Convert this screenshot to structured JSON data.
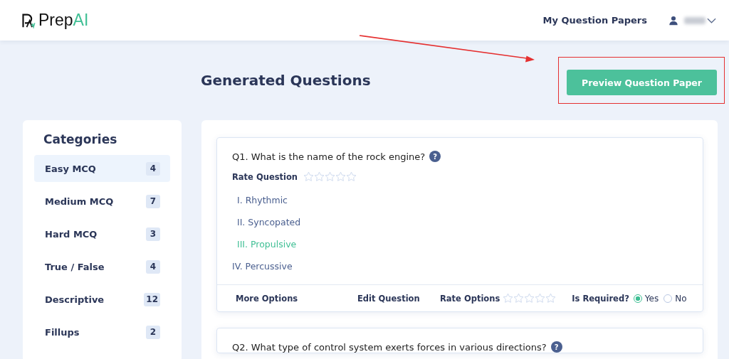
{
  "header": {
    "logo": {
      "text": "Prep",
      "accent": "AI"
    },
    "nav_link": "My Question Papers"
  },
  "title": "Generated Questions",
  "preview_button": {
    "label": "Preview Question Paper",
    "highlighted": true
  },
  "categories": {
    "title": "Categories",
    "items": [
      {
        "label": "Easy MCQ",
        "count": "4",
        "selected": true
      },
      {
        "label": "Medium MCQ",
        "count": "7",
        "selected": false
      },
      {
        "label": "Hard MCQ",
        "count": "3",
        "selected": false
      },
      {
        "label": "True / False",
        "count": "4",
        "selected": false
      },
      {
        "label": "Descriptive",
        "count": "12",
        "selected": false
      },
      {
        "label": "Fillups",
        "count": "2",
        "selected": false
      }
    ]
  },
  "questions": [
    {
      "text": "Q1. What is the name of the rock engine?",
      "help": "?",
      "rate_label": "Rate Question",
      "stars": 0,
      "options": [
        {
          "text": "I. Rhythmic",
          "correct": false
        },
        {
          "text": "II. Syncopated",
          "correct": false
        },
        {
          "text": "III. Propulsive",
          "correct": true
        },
        {
          "text": "IV. Percussive",
          "correct": false
        }
      ],
      "footer": {
        "more": "More Options",
        "edit": "Edit Question",
        "rate_label": "Rate Options",
        "stars": 0,
        "required_label": "Is Required?",
        "choices": [
          {
            "label": "Yes",
            "selected": true
          },
          {
            "label": "No",
            "selected": false
          }
        ]
      }
    },
    {
      "text": "Q2. What type of control system exerts forces in various directions?",
      "help": "?"
    }
  ]
}
